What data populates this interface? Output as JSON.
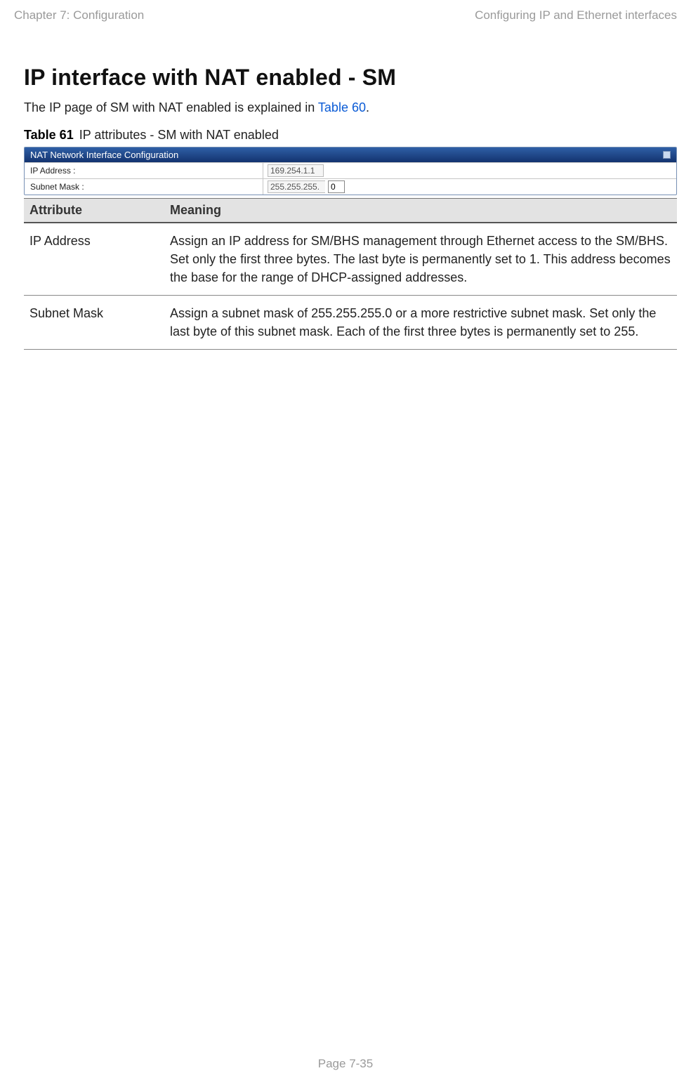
{
  "header": {
    "left": "Chapter 7:  Configuration",
    "right": "Configuring IP and Ethernet interfaces"
  },
  "section": {
    "title": "IP interface with NAT enabled - SM",
    "intro_pre": "The IP page of SM with NAT enabled is explained in ",
    "intro_link": "Table 60",
    "intro_post": "."
  },
  "caption": {
    "num": "Table 61",
    "title": "IP attributes - SM with NAT enabled"
  },
  "panel": {
    "title": "NAT Network Interface Configuration",
    "rows": [
      {
        "label": "IP Address :",
        "value": "169.254.1.1",
        "editable_last": null
      },
      {
        "label": "Subnet Mask :",
        "value": "255.255.255.",
        "editable_last": "0"
      }
    ]
  },
  "attr_table": {
    "headers": [
      "Attribute",
      "Meaning"
    ],
    "rows": [
      {
        "attr": "IP Address",
        "meaning": "Assign an IP address for SM/BHS management through Ethernet access to the SM/BHS. Set only the first three bytes. The last byte is permanently set to 1. This address becomes the base for the range of DHCP-assigned addresses."
      },
      {
        "attr": "Subnet Mask",
        "meaning": "Assign a subnet mask of 255.255.255.0 or a more restrictive subnet mask. Set only the last byte of this subnet mask. Each of the first three bytes is permanently set to 255."
      }
    ]
  },
  "footer": "Page 7-35"
}
